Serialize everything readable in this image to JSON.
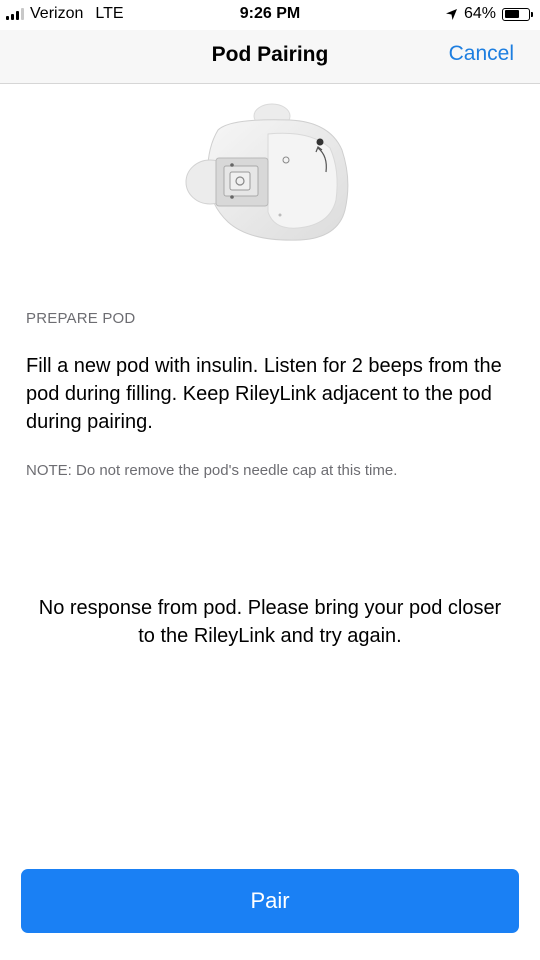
{
  "status_bar": {
    "carrier": "Verizon",
    "network": "LTE",
    "time": "9:26 PM",
    "battery_percent": "64%",
    "battery_level": 0.64,
    "signal_bars": 3
  },
  "nav": {
    "title": "Pod Pairing",
    "cancel_label": "Cancel"
  },
  "content": {
    "section_header": "PREPARE POD",
    "instructions": "Fill a new pod with insulin. Listen for 2 beeps from the pod during filling. Keep RileyLink adjacent to the pod during pairing.",
    "note": "NOTE: Do not remove the pod's needle cap at this time.",
    "error_message": "No response from pod. Please bring your pod closer to the RileyLink and try again."
  },
  "actions": {
    "pair_label": "Pair"
  },
  "colors": {
    "accent": "#1d7ee0",
    "button": "#1a80f4",
    "secondary_text": "#6d6d72"
  }
}
